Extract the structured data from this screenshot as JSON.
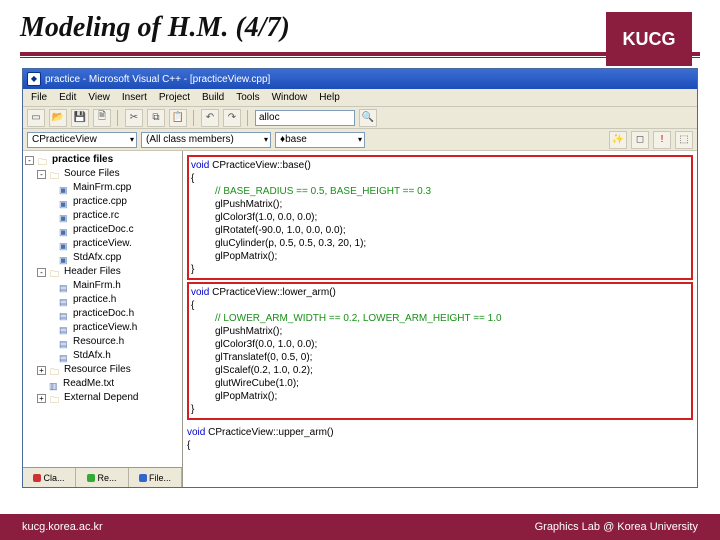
{
  "slide": {
    "title": "Modeling of H.M. (4/7)",
    "badge": "KUCG"
  },
  "ide": {
    "window_title": "practice - Microsoft Visual C++ - [practiceView.cpp]",
    "menus": [
      "File",
      "Edit",
      "View",
      "Insert",
      "Project",
      "Build",
      "Tools",
      "Window",
      "Help"
    ],
    "find_field": "alloc",
    "class_dd": "CPracticeView",
    "members_dd": "(All class members)",
    "func_dd": "base"
  },
  "tree": {
    "root": "practice files",
    "source_folder": "Source Files",
    "sources": [
      "MainFrm.cpp",
      "practice.cpp",
      "practice.rc",
      "practiceDoc.c",
      "practiceView.",
      "StdAfx.cpp"
    ],
    "header_folder": "Header Files",
    "headers": [
      "MainFrm.h",
      "practice.h",
      "practiceDoc.h",
      "practiceView.h",
      "Resource.h",
      "StdAfx.h"
    ],
    "resource_folder": "Resource Files",
    "readme": "ReadMe.txt",
    "external": "External Depend"
  },
  "sidebar_tabs": [
    "Cla...",
    "Re...",
    "File..."
  ],
  "code": {
    "fn1_sig": "void CPracticeView::base()",
    "fn1_comment": "// BASE_RADIUS == 0.5, BASE_HEIGHT == 0.3",
    "fn1_lines": [
      "glPushMatrix();",
      "glColor3f(1.0, 0.0, 0.0);",
      "glRotatef(-90.0, 1.0, 0.0, 0.0);",
      "gluCylinder(p, 0.5, 0.5, 0.3, 20, 1);",
      "glPopMatrix();"
    ],
    "fn2_sig": "void CPracticeView::lower_arm()",
    "fn2_comment": "// LOWER_ARM_WIDTH == 0.2, LOWER_ARM_HEIGHT == 1.0",
    "fn2_lines": [
      "glPushMatrix();",
      "glColor3f(0.0, 1.0, 0.0);",
      "glTranslatef(0, 0.5, 0);",
      "glScalef(0.2, 1.0, 0.2);",
      "glutWireCube(1.0);",
      "glPopMatrix();"
    ],
    "fn3_sig": "void CPracticeView::upper_arm()"
  },
  "footer": {
    "left": "kucg.korea.ac.kr",
    "right": "Graphics Lab @ Korea University"
  }
}
